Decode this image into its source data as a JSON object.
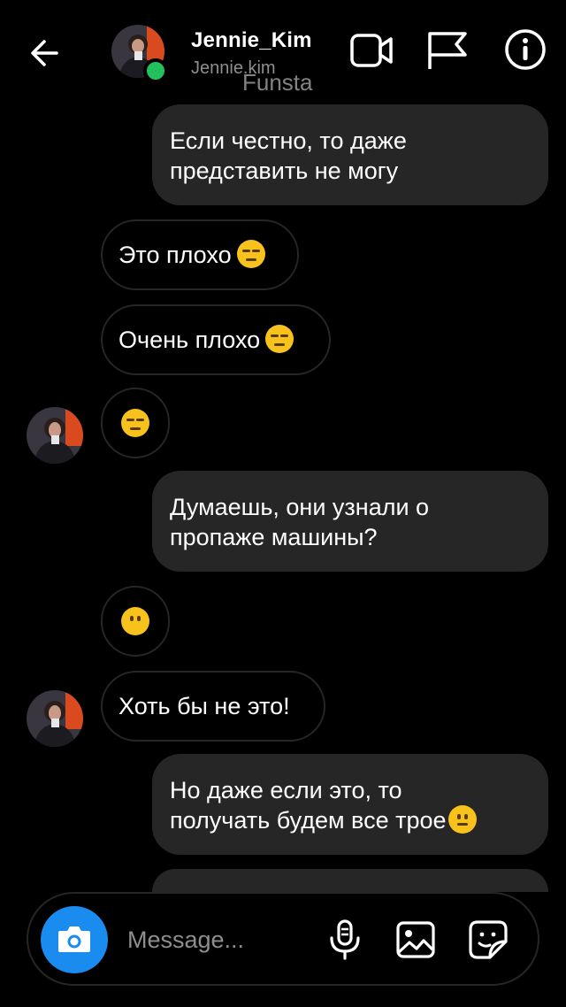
{
  "header": {
    "contact_name": "Jennie_Kim",
    "contact_handle": "Jennie.kim",
    "watermark": "Funsta",
    "icons": [
      "back-arrow-icon",
      "video-call-icon",
      "flag-icon",
      "info-icon"
    ],
    "online_color": "#22c15e"
  },
  "messages": [
    {
      "side": "outgoing",
      "lines": [
        "Если честно, то даже",
        "представить не могу"
      ]
    },
    {
      "side": "incoming",
      "text": "Это плохо",
      "emoji": "expressionless-face"
    },
    {
      "side": "incoming",
      "text": "Очень плохо",
      "emoji": "expressionless-face"
    },
    {
      "side": "incoming",
      "text": "",
      "emoji": "expressionless-face",
      "avatar": true
    },
    {
      "side": "outgoing",
      "lines": [
        "Думаешь, они узнали о",
        "пропаже машины?"
      ]
    },
    {
      "side": "incoming",
      "text": "",
      "emoji": "face-without-mouth"
    },
    {
      "side": "incoming",
      "text": "Хоть бы не это!",
      "avatar": true
    },
    {
      "side": "outgoing",
      "lines": [
        "Но даже если это, то",
        "получать будем все трое"
      ],
      "emoji": "neutral-face"
    }
  ],
  "composer": {
    "placeholder": "Message...",
    "camera_color": "#1a8cf0",
    "icons": [
      "camera-icon",
      "microphone-icon",
      "gallery-icon",
      "sticker-icon"
    ]
  },
  "theme": {
    "bubble_outgoing": "#262626",
    "bubble_incoming_border": "#262626",
    "background": "#000000"
  }
}
